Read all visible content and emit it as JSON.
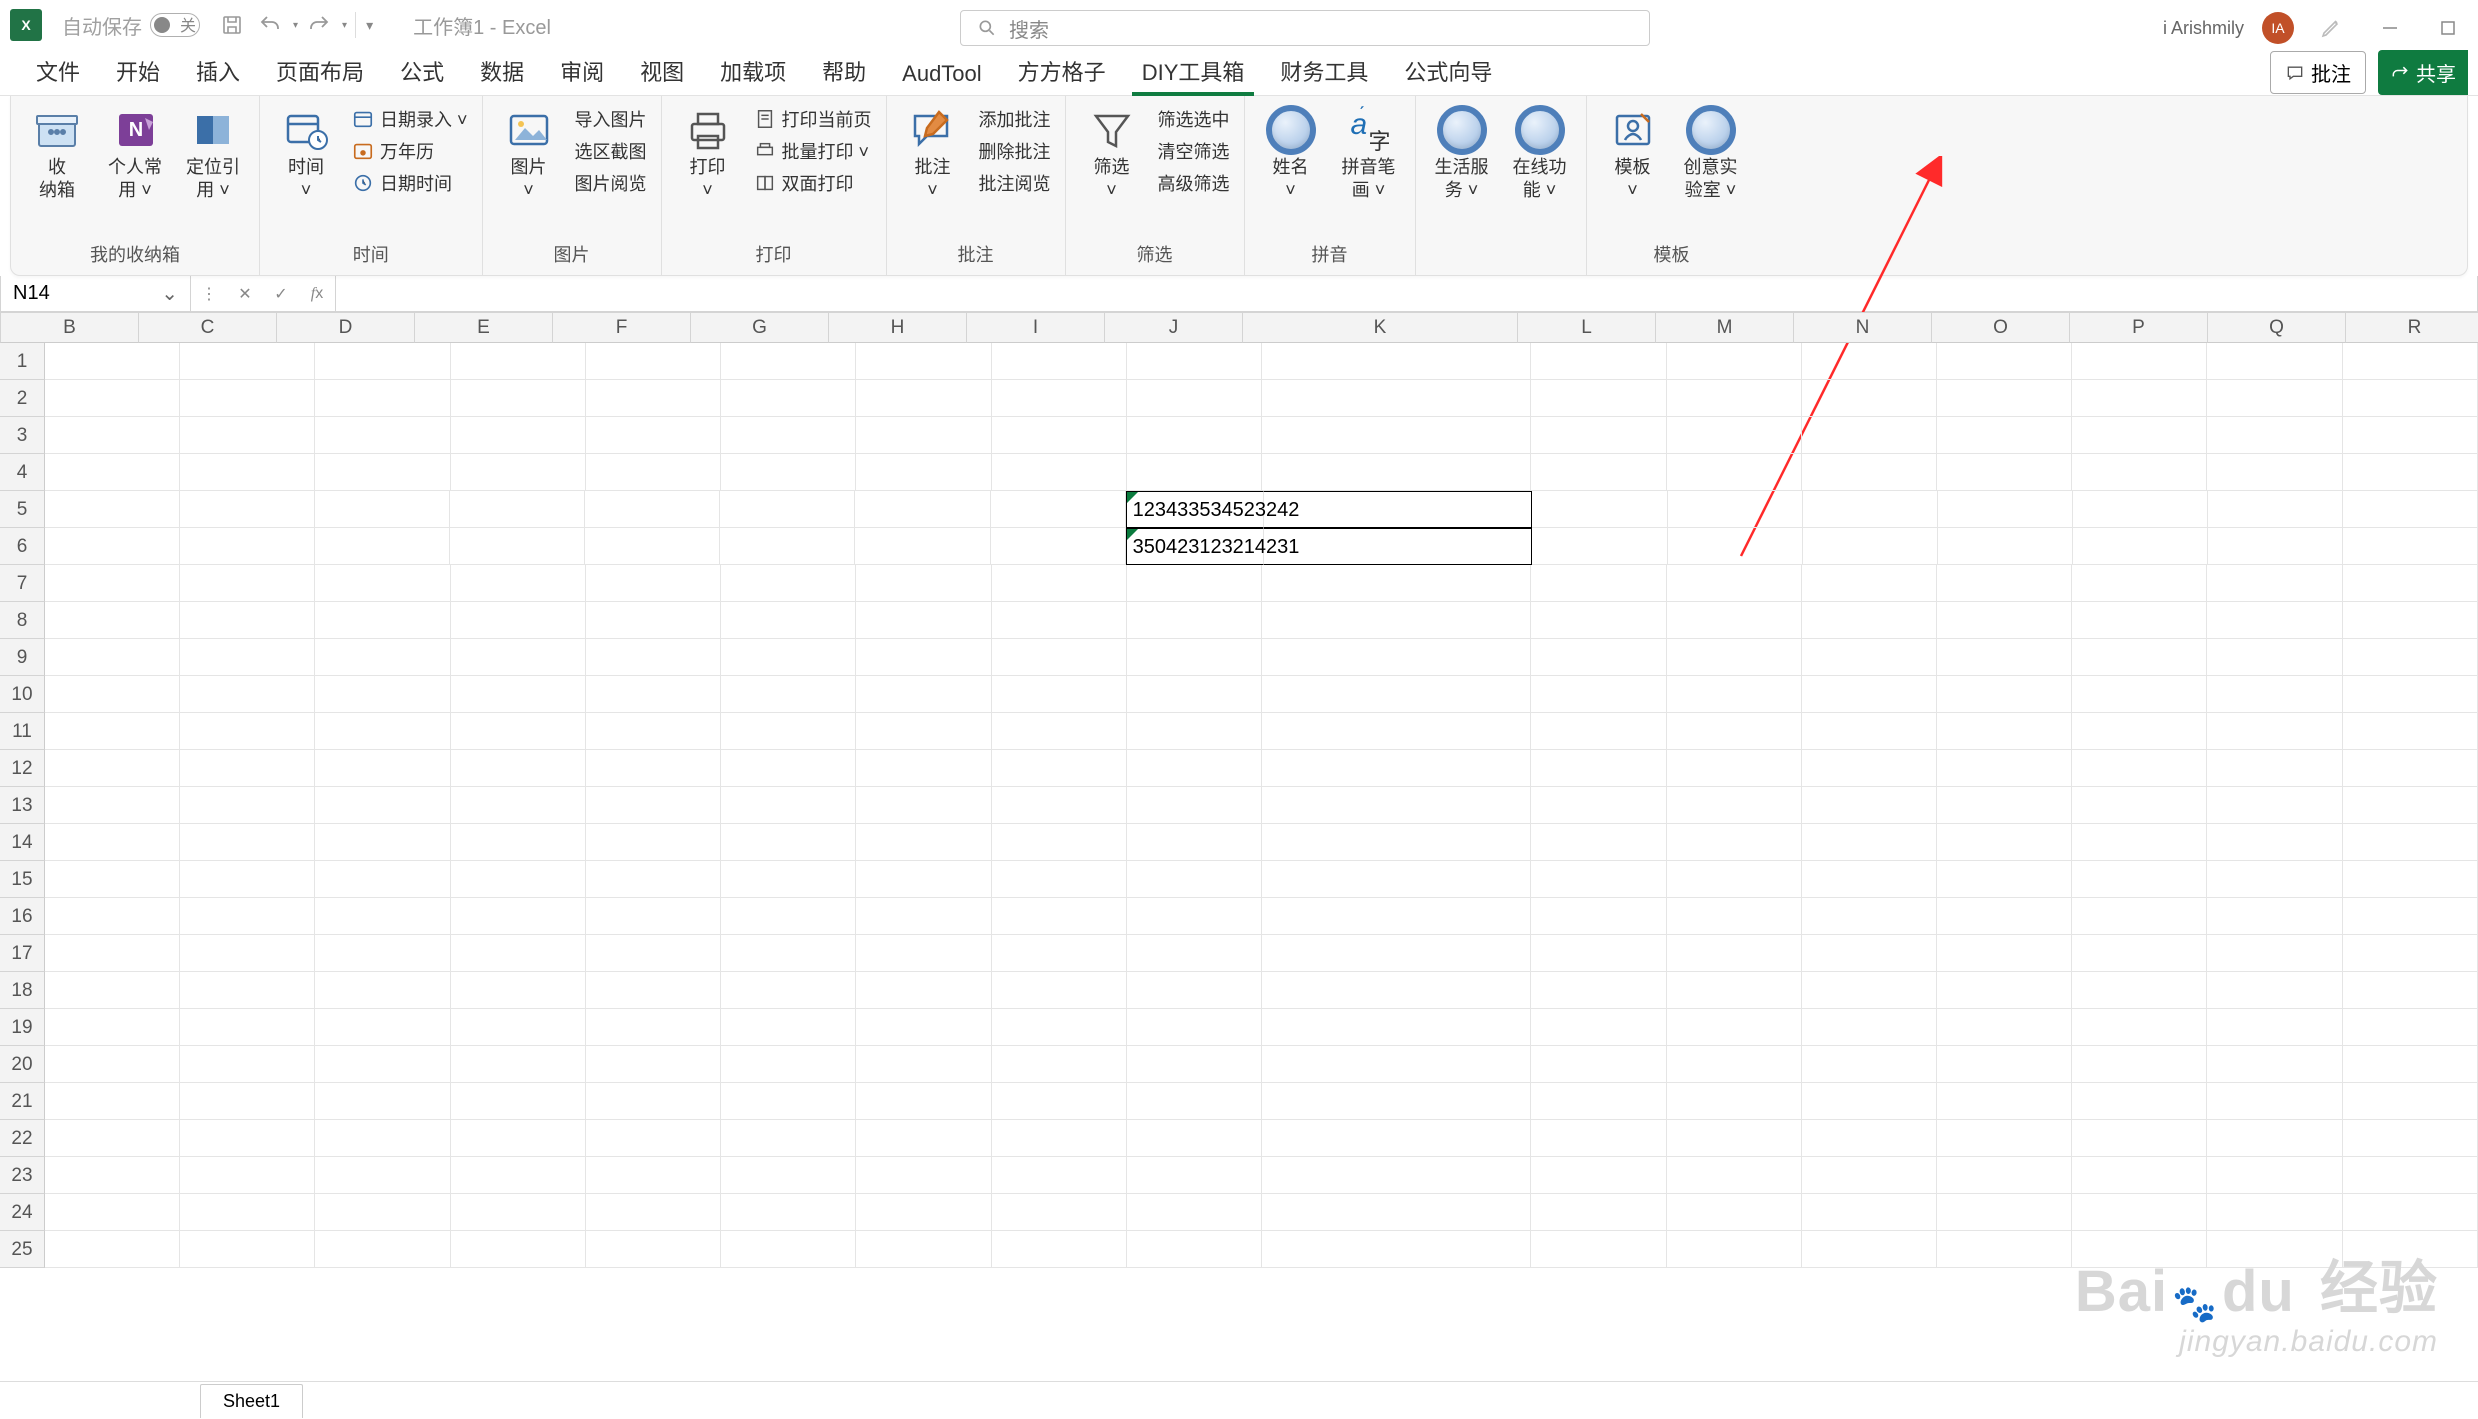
{
  "title_bar": {
    "autosave_label": "自动保存",
    "autosave_state": "关",
    "doc_title": "工作簿1 - Excel",
    "search_placeholder": "搜索",
    "user_name": "i Arishmily",
    "avatar_initials": "IA"
  },
  "tabs": {
    "items": [
      "文件",
      "开始",
      "插入",
      "页面布局",
      "公式",
      "数据",
      "审阅",
      "视图",
      "加载项",
      "帮助",
      "AudTool",
      "方方格子",
      "DIY工具箱",
      "财务工具",
      "公式向导"
    ],
    "active_index": 12,
    "comment_btn": "批注",
    "share_btn": "共享"
  },
  "ribbon": {
    "groups": [
      {
        "name": "我的收纳箱",
        "big": [
          {
            "label": "收\n纳箱",
            "icon": "box"
          },
          {
            "label": "个人常\n用 ˅",
            "icon": "onenote"
          },
          {
            "label": "定位引\n用 ˅",
            "icon": "locate"
          }
        ]
      },
      {
        "name": "时间",
        "big": [
          {
            "label": "时间\n˅",
            "icon": "calendar"
          }
        ],
        "small": [
          "日期录入  ˅",
          "万年历",
          "日期时间"
        ]
      },
      {
        "name": "图片",
        "big": [
          {
            "label": "图片\n˅",
            "icon": "picture"
          }
        ],
        "small": [
          "导入图片",
          "选区截图",
          "图片阅览"
        ]
      },
      {
        "name": "打印",
        "big": [
          {
            "label": "打印\n˅",
            "icon": "printer"
          }
        ],
        "small": [
          "打印当前页",
          "批量打印   ˅",
          "双面打印"
        ]
      },
      {
        "name": "批注",
        "big": [
          {
            "label": "批注\n˅",
            "icon": "comment"
          }
        ],
        "small": [
          "添加批注",
          "删除批注",
          "批注阅览"
        ]
      },
      {
        "name": "筛选",
        "big": [
          {
            "label": "筛选\n˅",
            "icon": "funnel"
          }
        ],
        "small": [
          "筛选选中",
          "清空筛选",
          "高级筛选"
        ]
      },
      {
        "name": "拼音",
        "big": [
          {
            "label": "姓名\n˅",
            "icon": "circle"
          },
          {
            "label": "拼音笔\n画 ˅",
            "icon": "pinyin"
          }
        ]
      },
      {
        "name": "",
        "big": [
          {
            "label": "生活服\n务 ˅",
            "icon": "circle"
          },
          {
            "label": "在线功\n能 ˅",
            "icon": "circle"
          }
        ]
      },
      {
        "name": "模板",
        "big": [
          {
            "label": "模板\n˅",
            "icon": "template"
          },
          {
            "label": "创意实\n验室 ˅",
            "icon": "circle"
          }
        ]
      }
    ]
  },
  "name_box": {
    "value": "N14"
  },
  "formula_bar": {
    "value": ""
  },
  "columns": [
    "B",
    "C",
    "D",
    "E",
    "F",
    "G",
    "H",
    "I",
    "J",
    "K",
    "L",
    "M",
    "N",
    "O",
    "P",
    "Q",
    "R"
  ],
  "row_count": 25,
  "cells": {
    "J5": "123433534523242",
    "J6": "350423123214231"
  },
  "sheet_tabs": {
    "active": "Sheet1"
  },
  "watermark": {
    "brand": "Baidu 经验",
    "url": "jingyan.baidu.com"
  }
}
